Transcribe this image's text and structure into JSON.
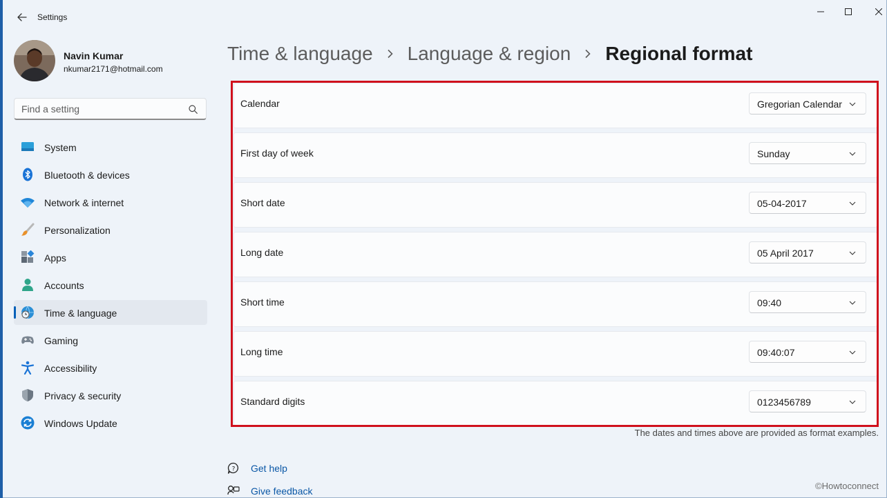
{
  "window": {
    "title": "Settings",
    "back_icon": "back-arrow-icon",
    "controls": [
      "minimize-icon",
      "maximize-icon",
      "close-icon"
    ]
  },
  "user": {
    "name": "Navin Kumar",
    "email": "nkumar2171@hotmail.com"
  },
  "search": {
    "placeholder": "Find a setting",
    "icon": "search-icon"
  },
  "sidebar": {
    "items": [
      {
        "label": "System",
        "icon": "system-icon",
        "active": false
      },
      {
        "label": "Bluetooth & devices",
        "icon": "bluetooth-icon",
        "active": false
      },
      {
        "label": "Network & internet",
        "icon": "wifi-icon",
        "active": false
      },
      {
        "label": "Personalization",
        "icon": "paintbrush-icon",
        "active": false
      },
      {
        "label": "Apps",
        "icon": "apps-icon",
        "active": false
      },
      {
        "label": "Accounts",
        "icon": "accounts-icon",
        "active": false
      },
      {
        "label": "Time & language",
        "icon": "globe-clock-icon",
        "active": true
      },
      {
        "label": "Gaming",
        "icon": "gamepad-icon",
        "active": false
      },
      {
        "label": "Accessibility",
        "icon": "accessibility-icon",
        "active": false
      },
      {
        "label": "Privacy & security",
        "icon": "shield-icon",
        "active": false
      },
      {
        "label": "Windows Update",
        "icon": "update-icon",
        "active": false
      }
    ]
  },
  "breadcrumb": {
    "items": [
      "Time & language",
      "Language & region",
      "Regional format"
    ]
  },
  "settings": {
    "rows": [
      {
        "label": "Calendar",
        "value": "Gregorian Calendar"
      },
      {
        "label": "First day of week",
        "value": "Sunday"
      },
      {
        "label": "Short date",
        "value": "05-04-2017"
      },
      {
        "label": "Long date",
        "value": "05 April 2017"
      },
      {
        "label": "Short time",
        "value": "09:40"
      },
      {
        "label": "Long time",
        "value": "09:40:07"
      },
      {
        "label": "Standard digits",
        "value": "0123456789"
      }
    ],
    "note": "The dates and times above are provided as format examples.",
    "highlight_color": "#d0101c"
  },
  "help": {
    "get_help": "Get help",
    "give_feedback": "Give feedback"
  },
  "watermark": "©Howtoconnect",
  "colors": {
    "accent": "#005fb8",
    "link": "#0a57a6",
    "background": "#eef3f9"
  }
}
